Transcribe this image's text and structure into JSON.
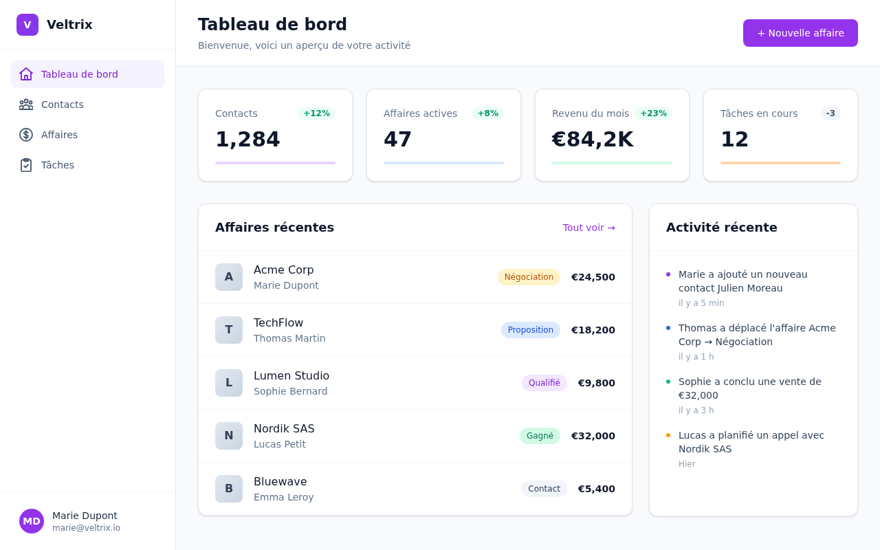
{
  "brand": {
    "logo_letter": "V",
    "name": "Veltrix"
  },
  "sidebar": {
    "items": [
      {
        "label": "Tableau de bord",
        "selected": true
      },
      {
        "label": "Contacts",
        "selected": false
      },
      {
        "label": "Affaires",
        "selected": false
      },
      {
        "label": "Tâches",
        "selected": false
      }
    ]
  },
  "user": {
    "initials": "MD",
    "name": "Marie Dupont",
    "email": "marie@veltrix.io"
  },
  "header": {
    "title": "Tableau de bord",
    "subtitle": "Bienvenue, voici un aperçu de votre activité",
    "button": "+ Nouvelle affaire"
  },
  "stats": [
    {
      "label": "Contacts",
      "change": "+12%",
      "kind": "up",
      "value": "1,284",
      "color": "#e9d5ff"
    },
    {
      "label": "Affaires actives",
      "change": "+8%",
      "kind": "up",
      "value": "47",
      "color": "#dbeafe"
    },
    {
      "label": "Revenu du mois",
      "change": "+23%",
      "kind": "up",
      "value": "€84,2K",
      "color": "#d1fae5"
    },
    {
      "label": "Tâches en cours",
      "change": "-3",
      "kind": "neutral",
      "value": "12",
      "color": "#fed7aa"
    }
  ],
  "deals": {
    "title": "Affaires récentes",
    "link": "Tout voir →",
    "rows": [
      {
        "initial": "A",
        "company": "Acme Corp",
        "contact": "Marie Dupont",
        "stage": {
          "label": "Négociation",
          "kind": "negotiation"
        },
        "amount": "€24,500"
      },
      {
        "initial": "T",
        "company": "TechFlow",
        "contact": "Thomas Martin",
        "stage": {
          "label": "Proposition",
          "kind": "proposal"
        },
        "amount": "€18,200"
      },
      {
        "initial": "L",
        "company": "Lumen Studio",
        "contact": "Sophie Bernard",
        "stage": {
          "label": "Qualifié",
          "kind": "qualified"
        },
        "amount": "€9,800"
      },
      {
        "initial": "N",
        "company": "Nordik SAS",
        "contact": "Lucas Petit",
        "stage": {
          "label": "Gagné",
          "kind": "won"
        },
        "amount": "€32,000"
      },
      {
        "initial": "B",
        "company": "Bluewave",
        "contact": "Emma Leroy",
        "stage": {
          "label": "Contact",
          "kind": "contact"
        },
        "amount": "€5,400"
      }
    ]
  },
  "activity": {
    "title": "Activité récente",
    "items": [
      {
        "text": "Marie a ajouté un nouveau contact Julien Moreau",
        "time": "il y a 5 min",
        "color": "#9333ea"
      },
      {
        "text": "Thomas a déplacé l'affaire Acme Corp → Négociation",
        "time": "il y a 1 h",
        "color": "#2563eb"
      },
      {
        "text": "Sophie a conclu une vente de €32,000",
        "time": "il y a 3 h",
        "color": "#10b981"
      },
      {
        "text": "Lucas a planifié un appel avec Nordik SAS",
        "time": "Hier",
        "color": "#f59e0b"
      }
    ]
  }
}
